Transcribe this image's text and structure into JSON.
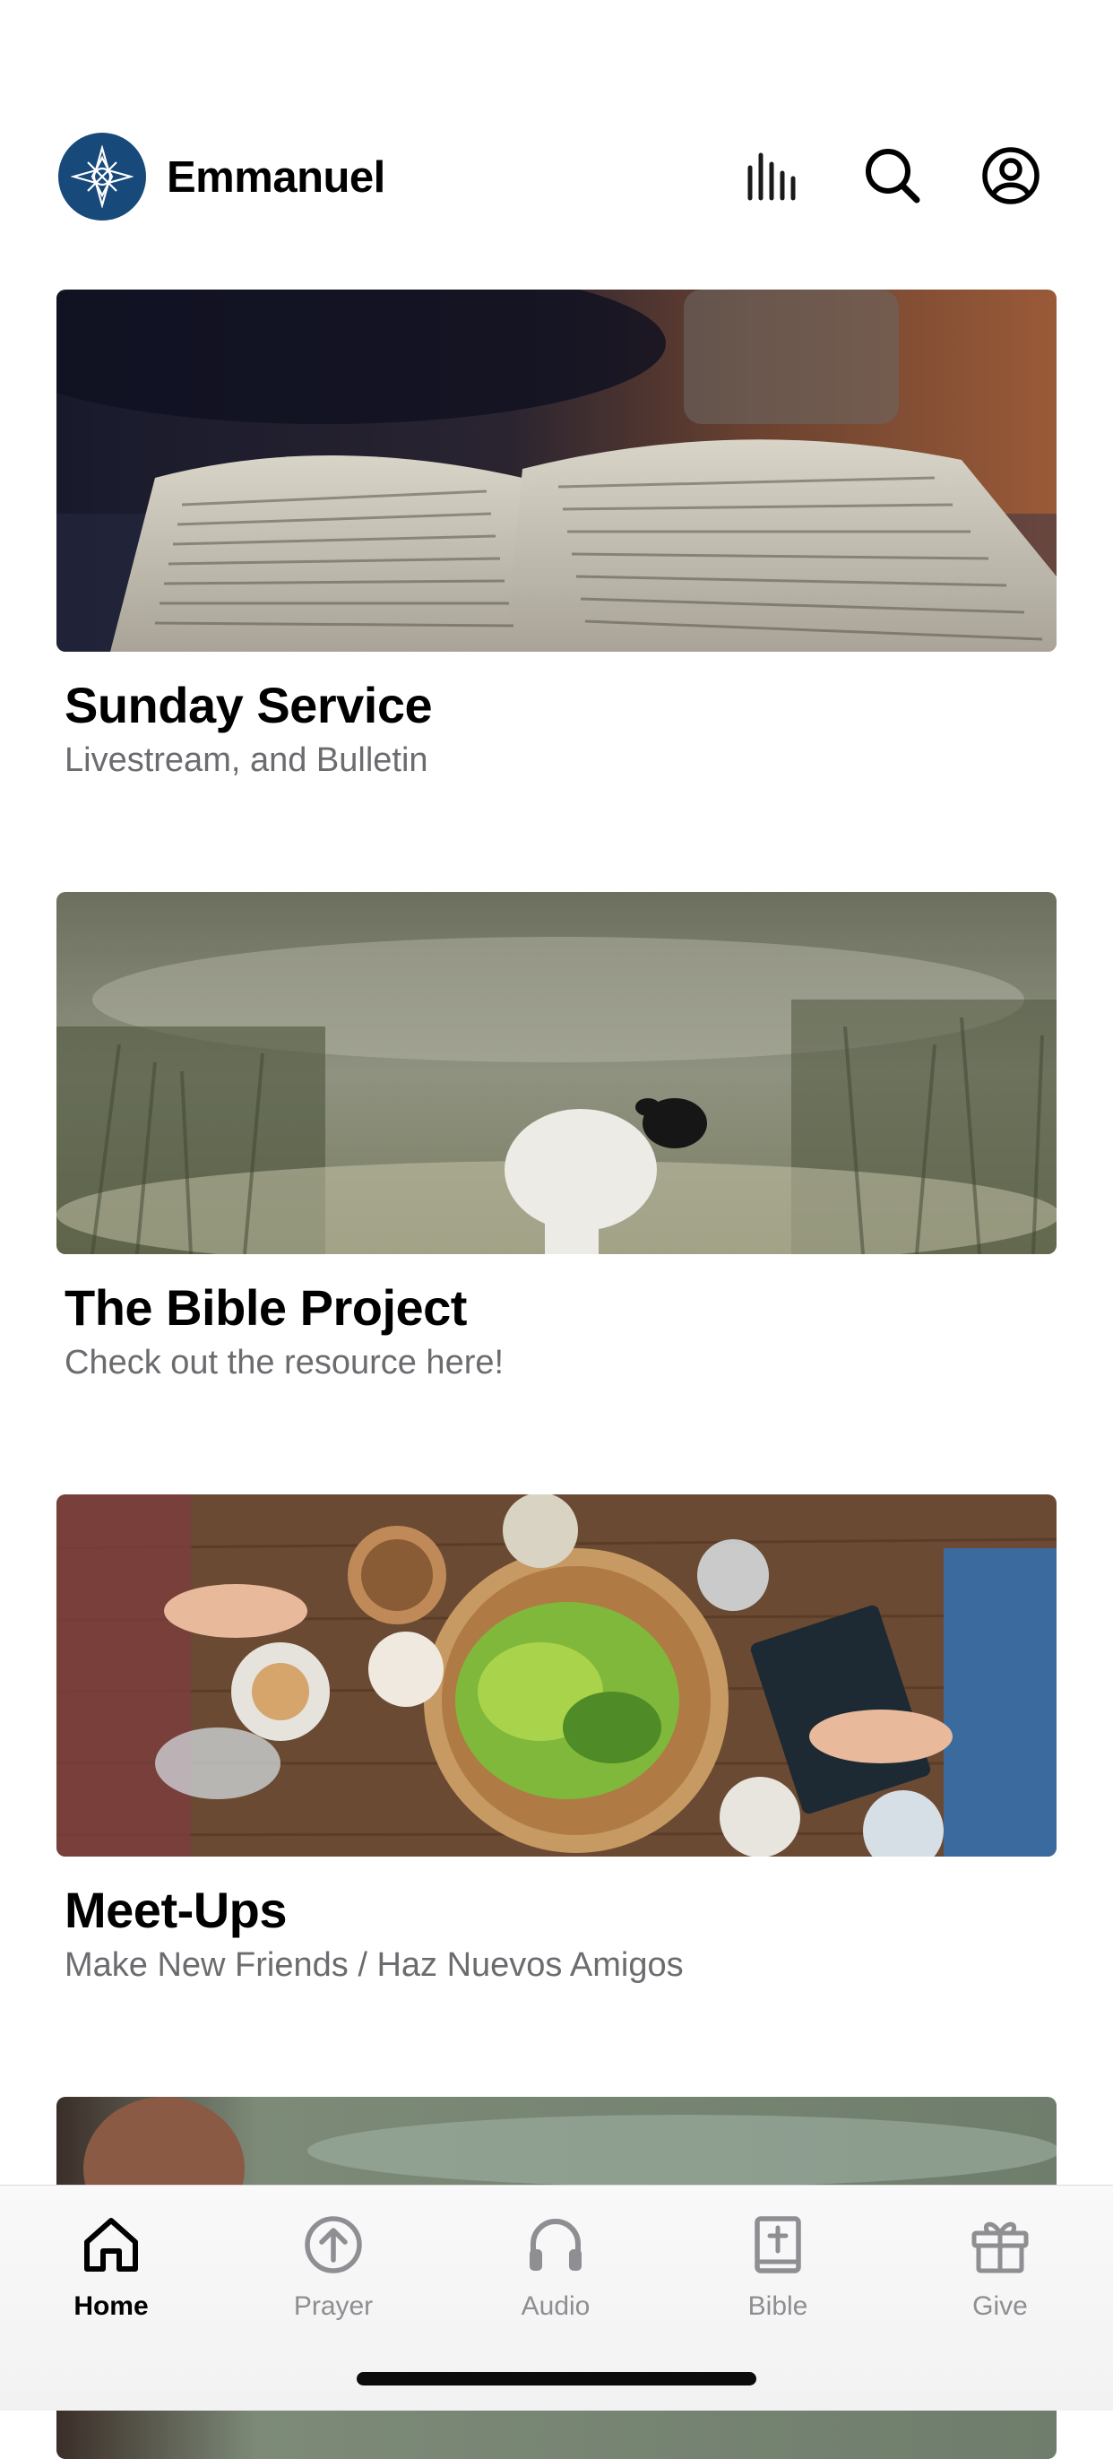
{
  "header": {
    "app_name": "Emmanuel",
    "brand_color": "#17497a",
    "icons": [
      "audio-bars-icon",
      "search-icon",
      "account-icon"
    ]
  },
  "feed": [
    {
      "title": "Sunday Service",
      "subtitle": "Livestream, and Bulletin",
      "image": "open-bible-photo"
    },
    {
      "title": "The Bible Project",
      "subtitle": "Check out the resource here!",
      "image": "lamb-in-field-photo"
    },
    {
      "title": "Meet-Ups",
      "subtitle": "Make New Friends / Haz Nuevos Amigos",
      "image": "shared-meal-table-photo"
    },
    {
      "title": "",
      "subtitle": "",
      "image": "partial-outdoor-photo"
    }
  ],
  "tabbar": {
    "tabs": [
      {
        "label": "Home",
        "icon": "home-icon",
        "active": true
      },
      {
        "label": "Prayer",
        "icon": "prayer-arrow-icon",
        "active": false
      },
      {
        "label": "Audio",
        "icon": "headphones-icon",
        "active": false
      },
      {
        "label": "Bible",
        "icon": "bible-icon",
        "active": false
      },
      {
        "label": "Give",
        "icon": "gift-icon",
        "active": false
      }
    ],
    "active_color": "#000000",
    "inactive_color": "#8e8e93"
  }
}
